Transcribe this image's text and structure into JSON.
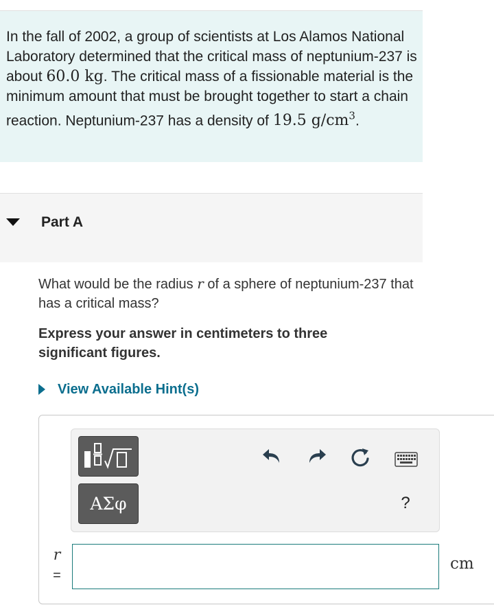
{
  "intro": {
    "text_1": "In the fall of 2002, a group of scientists at Los Alamos National Laboratory determined that the critical mass of neptunium-237 is about ",
    "mass": "60.0 kg",
    "text_2": ". The critical mass of a fissionable material is the minimum amount that must be brought together to start a chain reaction. Neptunium-237 has a density of ",
    "density": "19.5 g/cm",
    "density_exp": "3",
    "text_3": "."
  },
  "part": {
    "title": "Part A"
  },
  "question": {
    "text_1": "What would be the radius ",
    "var": "r",
    "text_2": " of a sphere of neptunium-237 that has a critical mass?"
  },
  "instruction": "Express your answer in centimeters to three significant figures.",
  "hint": {
    "label": "View Available Hint(s)"
  },
  "toolbar": {
    "greek_label": "ΑΣφ",
    "help_label": "?"
  },
  "answer": {
    "variable": "r",
    "equals": "=",
    "value": "",
    "unit": "cm"
  }
}
